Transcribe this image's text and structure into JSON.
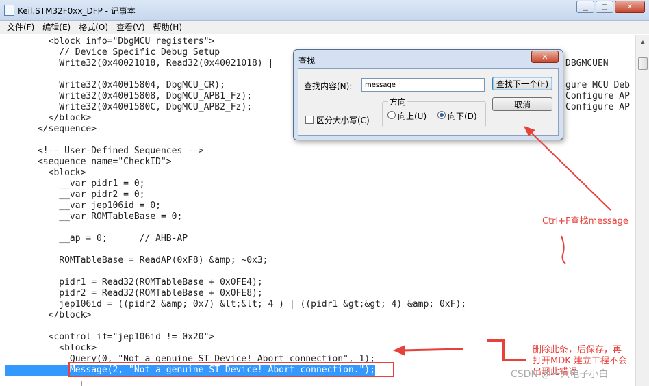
{
  "window": {
    "title": "Keil.STM32F0xx_DFP - 记事本",
    "minimize_glyph": "▁",
    "maximize_glyph": "▢",
    "close_glyph": "✕"
  },
  "menu": [
    "文件(F)",
    "编辑(E)",
    "格式(O)",
    "查看(V)",
    "帮助(H)"
  ],
  "editor_lines": [
    "        <block info=\"DbgMCU registers\">",
    "          // Device Specific Debug Setup",
    "          Write32(0x40021018, Read32(0x40021018) |",
    "",
    "          Write32(0x40015804, DbgMCU_CR);",
    "          Write32(0x40015808, DbgMCU_APB1_Fz);",
    "          Write32(0x4001580C, DbgMCU_APB2_Fz);",
    "        </block>",
    "      </sequence>",
    "",
    "      <!-- User-Defined Sequences -->",
    "      <sequence name=\"CheckID\">",
    "        <block>",
    "          __var pidr1 = 0;",
    "          __var pidr2 = 0;",
    "          __var jep106id = 0;",
    "          __var ROMTableBase = 0;",
    "",
    "          __ap = 0;      // AHB-AP",
    "",
    "          ROMTableBase = ReadAP(0xF8) &amp; ~0x3;",
    "",
    "          pidr1 = Read32(ROMTableBase + 0x0FE4);",
    "          pidr2 = Read32(ROMTableBase + 0x0FE8);",
    "          jep106id = ((pidr2 &amp; 0x7) &lt;&lt; 4 ) | ((pidr1 &gt;&gt; 4) &amp; 0xF);",
    "        </block>",
    "",
    "        <control if=\"jep106id != 0x20\">",
    "          <block>",
    "            Query(0, \"Not a genuine ST Device! Abort connection\", 1);",
    "            Message(2, \"Not a genuine ST Device! Abort connection.\");"
  ],
  "editor_right_fragments": [
    "DBGMCUEN",
    "gure MCU Deb",
    "Configure AP",
    "Configure AP"
  ],
  "find_dialog": {
    "title": "查找",
    "close_glyph": "✕",
    "find_label": "查找内容(N):",
    "find_value": "message",
    "find_next_button": "查找下一个(F)",
    "cancel_button": "取消",
    "direction_label": "方向",
    "up_label": "向上(U)",
    "down_label": "向下(D)",
    "direction_selected": "down",
    "match_case_label": "区分大小写(C)",
    "match_case_checked": false
  },
  "annotations": {
    "ctrlf_note": "Ctrl+F查找message",
    "delete_note_line1": "删除此条，后保存，再",
    "delete_note_line2": "打开MDK 建立工程不会",
    "delete_note_line3": "出现此错误",
    "accent_color": "#e8403a"
  },
  "watermark": "CSDN @一只电子小白"
}
